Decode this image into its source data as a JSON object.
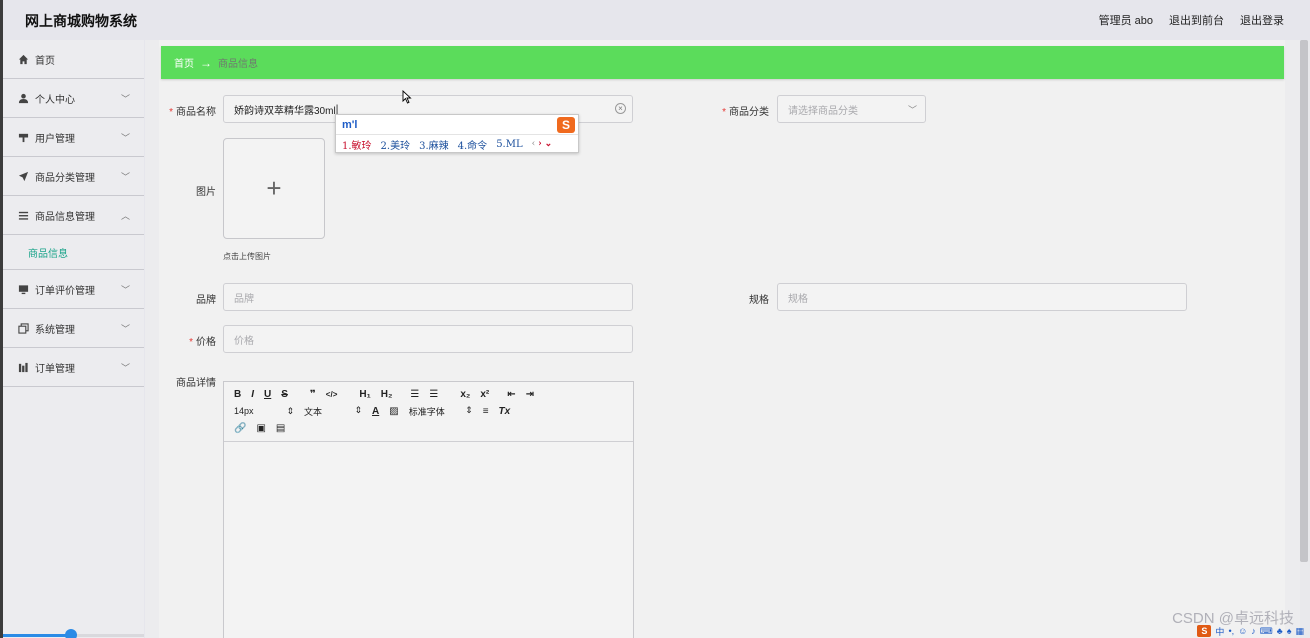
{
  "header": {
    "title": "网上商城购物系统",
    "admin": "管理员 abo",
    "to_front": "退出到前台",
    "logout": "退出登录"
  },
  "sidebar": {
    "items": [
      {
        "label": "首页",
        "icon": "home-icon"
      },
      {
        "label": "个人中心",
        "icon": "user-icon"
      },
      {
        "label": "用户管理",
        "icon": "pin-icon"
      },
      {
        "label": "商品分类管理",
        "icon": "send-icon"
      },
      {
        "label": "商品信息管理",
        "icon": "list-icon"
      },
      {
        "label": "商品信息",
        "sub": true
      },
      {
        "label": "订单评价管理",
        "icon": "monitor-icon"
      },
      {
        "label": "系统管理",
        "icon": "copy-icon"
      },
      {
        "label": "订单管理",
        "icon": "chart-icon"
      }
    ],
    "progress": 0.48
  },
  "breadcrumb": {
    "home": "首页",
    "arrow": "→",
    "current": "商品信息"
  },
  "form": {
    "name_label": "商品名称",
    "name_value": "娇韵诗双萃精华露30ml",
    "category_label": "商品分类",
    "category_placeholder": "请选择商品分类",
    "image_label": "图片",
    "upload_tip": "点击上传图片",
    "brand_label": "品牌",
    "brand_placeholder": "品牌",
    "spec_label": "规格",
    "spec_placeholder": "规格",
    "price_label": "价格",
    "price_placeholder": "价格",
    "detail_label": "商品详情"
  },
  "editor": {
    "font_size": "14px",
    "text_style": "文本",
    "font_family": "标准字体"
  },
  "ime": {
    "input": "m'l",
    "candidates": [
      "1.敏玲",
      "2.美玲",
      "3.麻辣",
      "4.命令",
      "5.ML"
    ],
    "logo": "S"
  },
  "watermark": "CSDN @卓远科技",
  "tray": {
    "zh": "中"
  }
}
